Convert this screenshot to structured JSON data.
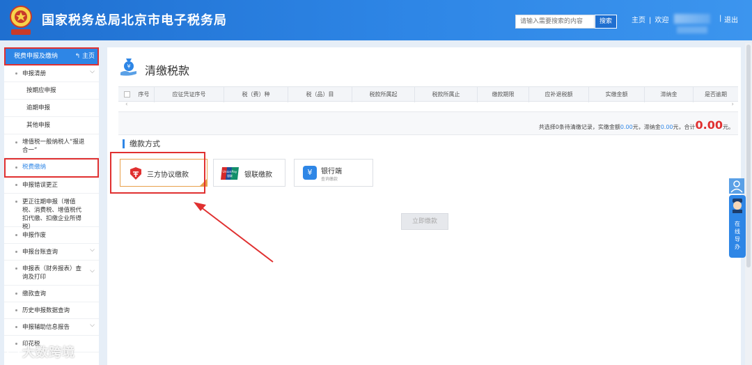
{
  "header": {
    "site_title": "国家税务总局北京市电子税务局",
    "search_placeholder": "请输入需要搜索的内容",
    "search_button": "搜索",
    "nav_home": "主页",
    "nav_sep": "|",
    "nav_welcome": "欢迎",
    "logout": "退出"
  },
  "sidebar": {
    "head_label": "税费申报及缴纳",
    "head_home": "主页",
    "items": [
      {
        "label": "申报清册",
        "expand": "⌵"
      },
      {
        "label": "按期应申报"
      },
      {
        "label": "逾期申报"
      },
      {
        "label": "其他申报"
      },
      {
        "label": "增值税一般纳税人“报退合一”"
      },
      {
        "label": "税费缴纳"
      },
      {
        "label": "申报错误更正"
      },
      {
        "label": "更正往期申报（增值税、消费税、增值税代扣代缴、扣缴企业所得税）"
      },
      {
        "label": "申报作废"
      },
      {
        "label": "申报台账查询",
        "expand": "⌵"
      },
      {
        "label": "申报表（财务报表）查询及打印",
        "expand": "⌵"
      },
      {
        "label": "缴款查询"
      },
      {
        "label": "历史申报数据查询"
      },
      {
        "label": "申报辅助信息报告",
        "expand": "⌵"
      },
      {
        "label": "印花税"
      }
    ]
  },
  "main": {
    "title": "清缴税款",
    "table_headers": [
      "序号",
      "应征凭证序号",
      "税（费）种",
      "税（品）目",
      "税款所属起",
      "税款所属止",
      "缴款期限",
      "应补退税额",
      "实缴金额",
      "滞纳金",
      "是否逾期"
    ],
    "summary": {
      "p1": "共选择",
      "count": "0",
      "p2": "条待清缴记录，实缴金额",
      "paid": "0.00",
      "p3": "元，滞纳金",
      "late": "0.00",
      "p4": "元，合计",
      "total": "0.00",
      "p5": "元。"
    },
    "section_title": "缴款方式",
    "pay_methods": {
      "tripartite": "三方协议缴款",
      "unionpay": "银联缴款",
      "unionpay_logo_text": "UnionPay",
      "unionpay_logo_cn": "银联",
      "bank": "银行端",
      "bank_sub": "查询缴款"
    },
    "pay_button": "立即缴款"
  },
  "float_widget": {
    "text": "在线导办"
  },
  "watermark": "大数跨境",
  "colors": {
    "brand_blue": "#2e86e6",
    "highlight_red": "#e03030",
    "accent_orange": "#e8a04a"
  }
}
